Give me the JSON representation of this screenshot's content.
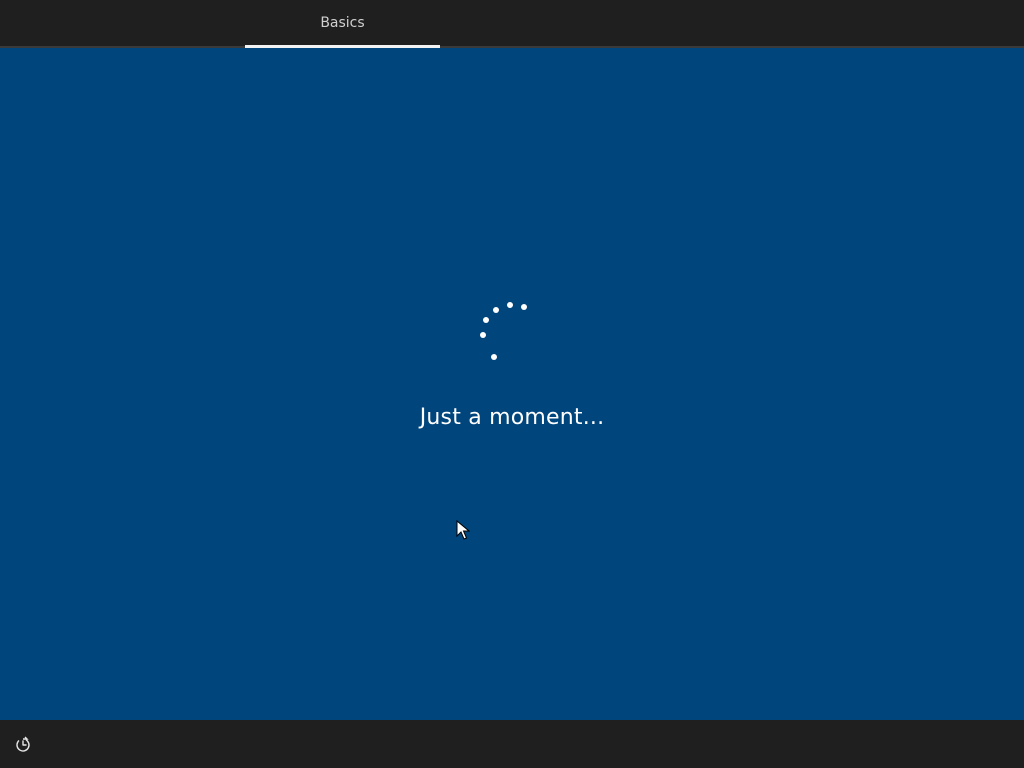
{
  "header": {
    "tabs": [
      {
        "label": "Basics",
        "active": true
      }
    ]
  },
  "main": {
    "status_message": "Just a moment...",
    "spinner_icon": "loading-spinner-icon",
    "background_color": "#00457c"
  },
  "footer": {
    "ease_of_access_icon": "ease-of-access-icon"
  },
  "colors": {
    "chrome": "#1f1f1f",
    "accent_underline": "#f2f2f2",
    "text": "#ffffff"
  }
}
